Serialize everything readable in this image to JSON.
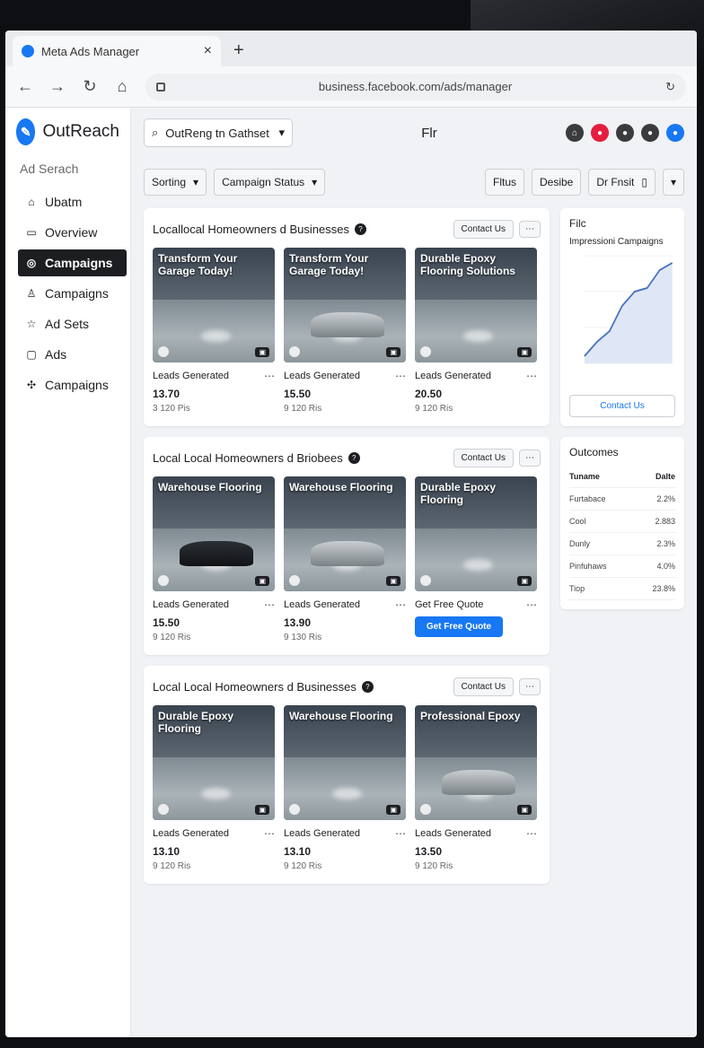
{
  "browser": {
    "tab_title": "Meta Ads Manager",
    "tab_close": "×",
    "new_tab": "+",
    "url": "business.facebook.com/ads/manager"
  },
  "brand": {
    "name": "OutReach"
  },
  "sidebar": {
    "search_label": "Ad Serach",
    "items": [
      {
        "label": "Ubatm",
        "icon": "bulb-icon"
      },
      {
        "label": "Overview",
        "icon": "overview-icon"
      },
      {
        "label": "Campaigns",
        "icon": "campaign-icon",
        "active": true
      },
      {
        "label": "Campaigns",
        "icon": "person-icon"
      },
      {
        "label": "Ad Sets",
        "icon": "star-icon"
      },
      {
        "label": "Ads",
        "icon": "ad-icon"
      },
      {
        "label": "Campaigns",
        "icon": "puzzle-icon"
      }
    ]
  },
  "header": {
    "search_value": "OutReng tn Gathset",
    "title": "Flr"
  },
  "filters": {
    "sorting": "Sorting",
    "campaign_status": "Campaign Status",
    "filter_1": "Fltus",
    "filter_2": "Desibe",
    "filter_3": "Dr Fnsit"
  },
  "campaigns": [
    {
      "title": "Locallocal Homeowners d Businesses",
      "contact": "Contact Us",
      "ads": [
        {
          "headline": "Transform Your Garage Today!",
          "metric": "Leads Generated",
          "value": "13.70",
          "sub": "3 120 Pis"
        },
        {
          "headline": "Transform Your Garage Today!",
          "metric": "Leads Generated",
          "value": "15.50",
          "sub": "9 120 Ris"
        },
        {
          "headline": "Durable Epoxy Flooring Solutions",
          "metric": "Leads Generated",
          "value": "20.50",
          "sub": "9 120 Ris"
        }
      ]
    },
    {
      "title": "Local Local Homeowners d Briobees",
      "contact": "Contact Us",
      "ads": [
        {
          "headline": "Warehouse Flooring",
          "metric": "Leads Generated",
          "value": "15.50",
          "sub": "9 120 Ris"
        },
        {
          "headline": "Warehouse Flooring",
          "metric": "Leads Generated",
          "value": "13.90",
          "sub": "9 130 Ris"
        },
        {
          "headline": "Durable Epoxy Flooring",
          "metric": "Get Free Quote",
          "cta": "Get Free Quote"
        }
      ]
    },
    {
      "title": "Local Local Homeowners d Businesses",
      "contact": "Contact Us",
      "ads": [
        {
          "headline": "Durable Epoxy Flooring",
          "metric": "Leads Generated",
          "value": "13.10",
          "sub": "9 120 Ris"
        },
        {
          "headline": "Warehouse Flooring",
          "metric": "Leads Generated",
          "value": "13.10",
          "sub": "9 120 Ris"
        },
        {
          "headline": "Professional Epoxy",
          "metric": "Leads Generated",
          "value": "13.50",
          "sub": "9 120 Ris"
        }
      ]
    }
  ],
  "right_panel": {
    "title": "Filc",
    "chart_title": "Impressioni Campaigns",
    "cta": "Contact Us",
    "outcomes_title": "Outcomes",
    "rows": [
      {
        "label": "Tuname",
        "value": "Dalte"
      },
      {
        "label": "Furtabace",
        "value": "2.2%"
      },
      {
        "label": "Cool",
        "value": "2.883"
      },
      {
        "label": "Dunly",
        "value": "2.3%"
      },
      {
        "label": "Pinfuhaws",
        "value": "4.0%"
      },
      {
        "label": "Tiop",
        "value": "23.8%"
      }
    ]
  },
  "chart_data": {
    "type": "area",
    "title": "Impressioni Campaigns",
    "x": [
      1,
      2,
      3,
      4,
      5,
      6,
      7,
      8
    ],
    "y": [
      0.2,
      0.6,
      0.9,
      1.6,
      2.0,
      2.1,
      2.6,
      2.8
    ],
    "ylim": [
      0,
      3
    ],
    "color": "#4a72c4"
  }
}
